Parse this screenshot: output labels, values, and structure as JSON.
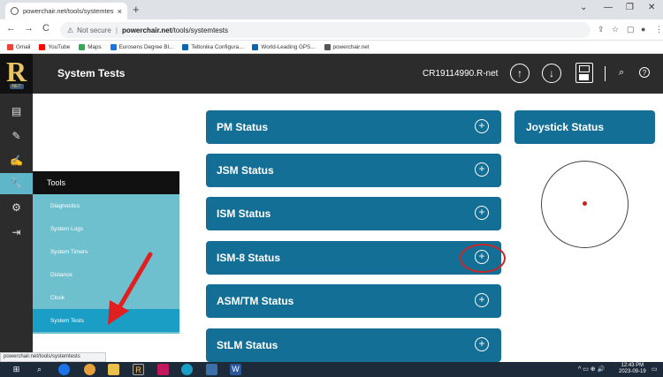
{
  "browser": {
    "tab_title": "powerchair.net/tools/systemtests",
    "tab_close": "×",
    "new_tab": "+",
    "window_controls": {
      "minimize": "—",
      "restore": "❐",
      "close": "✕",
      "menu": "⌄"
    },
    "nav": {
      "back": "←",
      "forward": "→",
      "reload": "C"
    },
    "address": {
      "security": "Not secure",
      "domain": "powerchair.net",
      "path": "/tools/systemtests"
    },
    "bookmarks": [
      {
        "label": "Gmail",
        "color": "#ea4335"
      },
      {
        "label": "YouTube",
        "color": "#ff0000"
      },
      {
        "label": "Maps",
        "color": "#34a853"
      },
      {
        "label": "Eurosens Degree Bl...",
        "color": "#1a73e8"
      },
      {
        "label": "Teltonika Configura...",
        "color": "#0b66b0"
      },
      {
        "label": "World-Leading GPS...",
        "color": "#0b66b0"
      },
      {
        "label": "powerchair.net",
        "color": "#555555"
      }
    ],
    "status_url": "powerchair.net/tools/systemtests"
  },
  "app": {
    "logo_letter": "R",
    "logo_sub": "NET",
    "title": "System Tests",
    "filename": "CR19114990.R-net",
    "upload_icon": "↑",
    "download_icon": "↓",
    "search_icon": "⌕",
    "help_icon": "?"
  },
  "rail": [
    {
      "icon": "document-icon",
      "glyph": "▤"
    },
    {
      "icon": "pencil-icon",
      "glyph": "✎"
    },
    {
      "icon": "signature-icon",
      "glyph": "✍"
    },
    {
      "icon": "wrench-icon",
      "glyph": "🔧",
      "active": true
    },
    {
      "icon": "gear-icon",
      "glyph": "⚙"
    },
    {
      "icon": "logout-icon",
      "glyph": "⇥"
    }
  ],
  "tools_menu": {
    "header": "Tools",
    "items": [
      "Diagnostics",
      "System Logs",
      "System Timers",
      "Distance",
      "Clock",
      "System Tests"
    ],
    "active_index": 5
  },
  "panels": [
    {
      "label": "PM Status"
    },
    {
      "label": "JSM Status"
    },
    {
      "label": "ISM Status"
    },
    {
      "label": "ISM-8 Status"
    },
    {
      "label": "ASM/TM Status"
    },
    {
      "label": "StLM Status"
    }
  ],
  "expand_icon": "+",
  "joystick": {
    "label": "Joystick Status"
  },
  "taskbar": {
    "tray_icons": "^ ▭ ⊕ 🔊",
    "time": "12:43 PM",
    "date": "2023-09-19"
  },
  "colors": {
    "panel": "#146f96",
    "header": "#2c2c2c",
    "flyout": "#6fc0cf",
    "flyout_active": "#1a9ec5",
    "annotation": "#c62828"
  }
}
